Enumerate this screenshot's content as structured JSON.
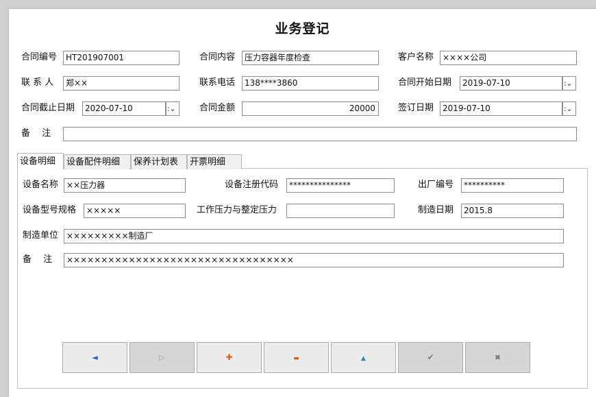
{
  "title": "业务登记",
  "contract": {
    "number": {
      "label": "合同编号",
      "value": "HT201907001"
    },
    "content": {
      "label": "合同内容",
      "value": "压力容器年度检查"
    },
    "customer": {
      "label": "客户名称",
      "value": "××××公司"
    },
    "contact": {
      "label": "联 系 人",
      "value": "郑××"
    },
    "phone": {
      "label": "联系电话",
      "value": "138****3860"
    },
    "start_date": {
      "label": "合同开始日期",
      "value": "2019-07-10"
    },
    "end_date": {
      "label": "合同截止日期",
      "value": "2020-07-10"
    },
    "amount": {
      "label": "合同金额",
      "value": "20000"
    },
    "sign_date": {
      "label": "签订日期",
      "value": "2019-07-10"
    },
    "remark": {
      "label": "备　 注",
      "value": ""
    }
  },
  "tabs": [
    "设备明细",
    "设备配件明细",
    "保养计划表",
    "开票明细"
  ],
  "equipment": {
    "name": {
      "label": "设备名称",
      "value": "××压力器"
    },
    "reg_code": {
      "label": "设备注册代码",
      "value": "***************"
    },
    "serial": {
      "label": "出厂编号",
      "value": "**********"
    },
    "model": {
      "label": "设备型号规格",
      "value": "×××××"
    },
    "pressure": {
      "label": "工作压力与整定压力",
      "value": ""
    },
    "mfg_date": {
      "label": "制造日期",
      "value": "2015.8"
    },
    "maker": {
      "label": "制造单位",
      "value": "×××××××××制造厂"
    },
    "remark": {
      "label": "备　 注",
      "value": "×××××××××××××××××××××××××××××××××"
    }
  },
  "nav": {
    "prev": "◄",
    "next": "▷",
    "add": "✚",
    "delete": "▬",
    "up": "▲",
    "confirm": "✔",
    "cancel": "✖"
  },
  "colors": {
    "prev": "#1f5fc4",
    "next": "#9a9a9a",
    "add": "#e0581c",
    "delete": "#e0581c",
    "up": "#1f8fa0",
    "confirm": "#7a7a7a",
    "cancel": "#7a7a7a"
  }
}
